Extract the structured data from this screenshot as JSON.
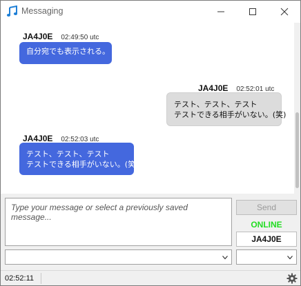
{
  "window": {
    "title": "Messaging"
  },
  "chat": {
    "messages": [
      {
        "sender": "JA4J0E",
        "time": "02:49:50 utc",
        "direction": "incoming",
        "lines": [
          "自分宛でも表示される。"
        ]
      },
      {
        "sender": "JA4J0E",
        "time": "02:52:01 utc",
        "direction": "outgoing",
        "lines": [
          "テスト、テスト、テスト",
          "テストできる相手がいない。(笑)"
        ]
      },
      {
        "sender": "JA4J0E",
        "time": "02:52:03 utc",
        "direction": "incoming",
        "lines": [
          "テスト、テスト、テスト",
          "テストできる相手がいない。(笑)"
        ]
      }
    ]
  },
  "compose": {
    "placeholder": "Type your message or select a previously saved message...",
    "send_label": "Send",
    "status": "ONLINE",
    "callsign": "JA4J0E"
  },
  "statusbar": {
    "clock": "02:52:11"
  },
  "colors": {
    "incoming_bubble": "#4468de",
    "outgoing_bubble": "#dcdcdc",
    "online": "#22dd22"
  },
  "icons": {
    "app": "music-note-icon",
    "minimize": "minimize-icon",
    "maximize": "maximize-icon",
    "close": "close-icon",
    "dropdown": "chevron-down-icon",
    "settings": "gear-icon"
  }
}
